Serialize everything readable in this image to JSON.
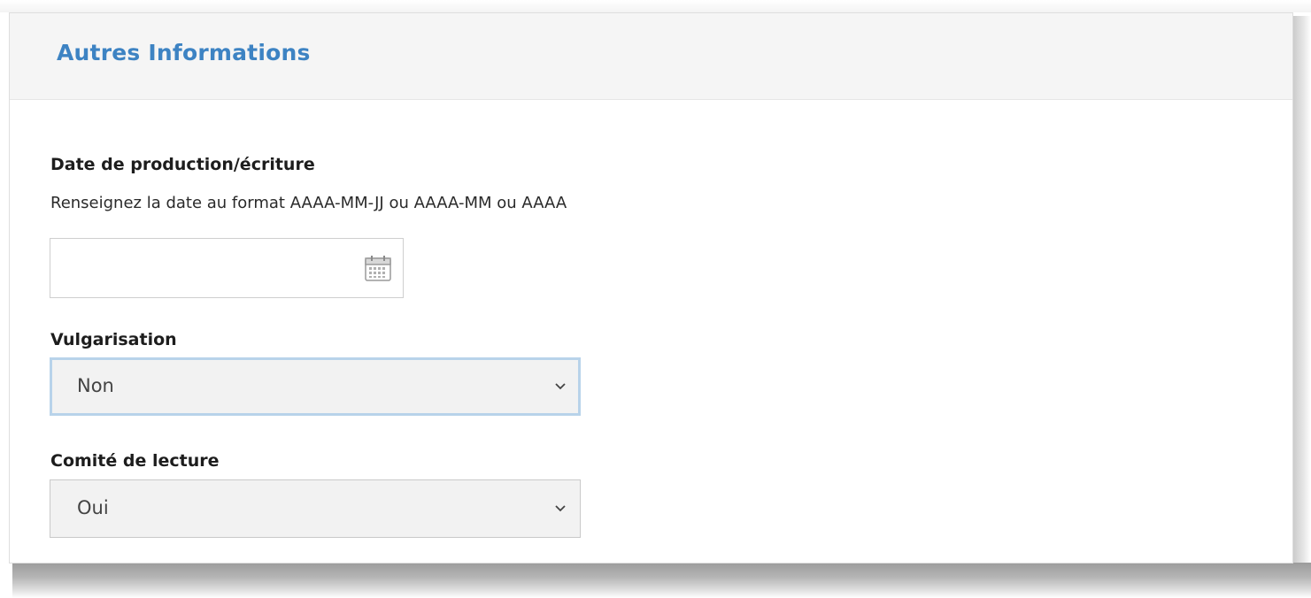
{
  "panel": {
    "title": "Autres Informations"
  },
  "fields": {
    "date": {
      "label": "Date de production/écriture",
      "help": "Renseignez la date au format AAAA-MM-JJ ou AAAA-MM ou AAAA",
      "value": "",
      "icon": "calendar-icon"
    },
    "vulgarisation": {
      "label": "Vulgarisation",
      "value": "Non",
      "icon": "chevron-down-icon"
    },
    "comite": {
      "label": "Comité de lecture",
      "value": "Oui",
      "icon": "chevron-down-icon"
    }
  },
  "colors": {
    "title": "#3d83c3",
    "focus_ring": "#b8d3ea",
    "select_bg": "#f2f2f2"
  }
}
